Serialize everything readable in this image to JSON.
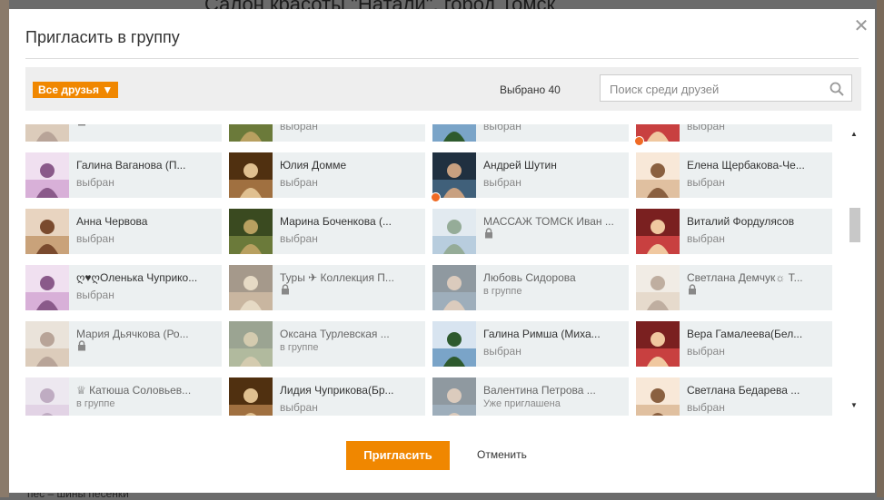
{
  "background": {
    "title": "Салон красоты \"Натали\", город Томск",
    "bottom_text": "пес – шины песенки"
  },
  "dialog": {
    "title": "Пригласить в группу",
    "close_icon": "close-icon",
    "filter_label": "Все друзья ▼",
    "selected_count": "Выбрано 40",
    "search_placeholder": "Поиск среди друзей",
    "search_icon": "search-icon",
    "invite_label": "Пригласить",
    "cancel_label": "Отменить",
    "accent_color": "#f08700"
  },
  "friends": [
    {
      "name": "",
      "status": "",
      "locked": true,
      "online": false
    },
    {
      "name": "",
      "status": "выбран",
      "locked": false,
      "online": false
    },
    {
      "name": "",
      "status": "выбран",
      "locked": false,
      "online": false
    },
    {
      "name": "",
      "status": "выбран",
      "locked": false,
      "online": true
    },
    {
      "name": "Галина Ваганова (П...",
      "status": "выбран",
      "locked": false,
      "online": false
    },
    {
      "name": "Юлия Домме",
      "status": "выбран",
      "locked": false,
      "online": false
    },
    {
      "name": "Андрей Шутин",
      "status": "выбран",
      "locked": false,
      "online": true
    },
    {
      "name": "Елена Щербакова-Че...",
      "status": "выбран",
      "locked": false,
      "online": false
    },
    {
      "name": "Анна Червова",
      "status": "выбран",
      "locked": false,
      "online": false
    },
    {
      "name": "Марина Боченкова (...",
      "status": "выбран",
      "locked": false,
      "online": false
    },
    {
      "name": "МАССАЖ ТОМСК Иван ...",
      "status": "",
      "locked": true,
      "online": false
    },
    {
      "name": "Виталий Фордулясов",
      "status": "выбран",
      "locked": false,
      "online": false
    },
    {
      "name": "ღ♥ღОленька Чуприко...",
      "status": "выбран",
      "locked": false,
      "online": false
    },
    {
      "name": "Туры ✈ Коллекция П...",
      "status": "",
      "locked": true,
      "online": false
    },
    {
      "name": "Любовь Сидорова",
      "status": "в группе",
      "locked": true,
      "online": false
    },
    {
      "name": "Светлана Демчук☼ Т...",
      "status": "",
      "locked": true,
      "online": false
    },
    {
      "name": "Мария Дьячкова (Ро...",
      "status": "",
      "locked": true,
      "online": false
    },
    {
      "name": "Оксана Турлевская ...",
      "status": "в группе",
      "locked": true,
      "online": false
    },
    {
      "name": "Галина Римша (Миха...",
      "status": "выбран",
      "locked": false,
      "online": false
    },
    {
      "name": "Вера Гамалеева(Бел...",
      "status": "выбран",
      "locked": false,
      "online": false
    },
    {
      "name": "♕ Катюша Соловьев...",
      "status": "в группе",
      "locked": true,
      "online": false
    },
    {
      "name": "Лидия Чуприкова(Бр...",
      "status": "выбран",
      "locked": false,
      "online": false
    },
    {
      "name": "Валентина Петрова ...",
      "status": "Уже приглашена",
      "locked": true,
      "online": false
    },
    {
      "name": "Светлана Бедарева ...",
      "status": "выбран",
      "locked": false,
      "online": false
    }
  ]
}
